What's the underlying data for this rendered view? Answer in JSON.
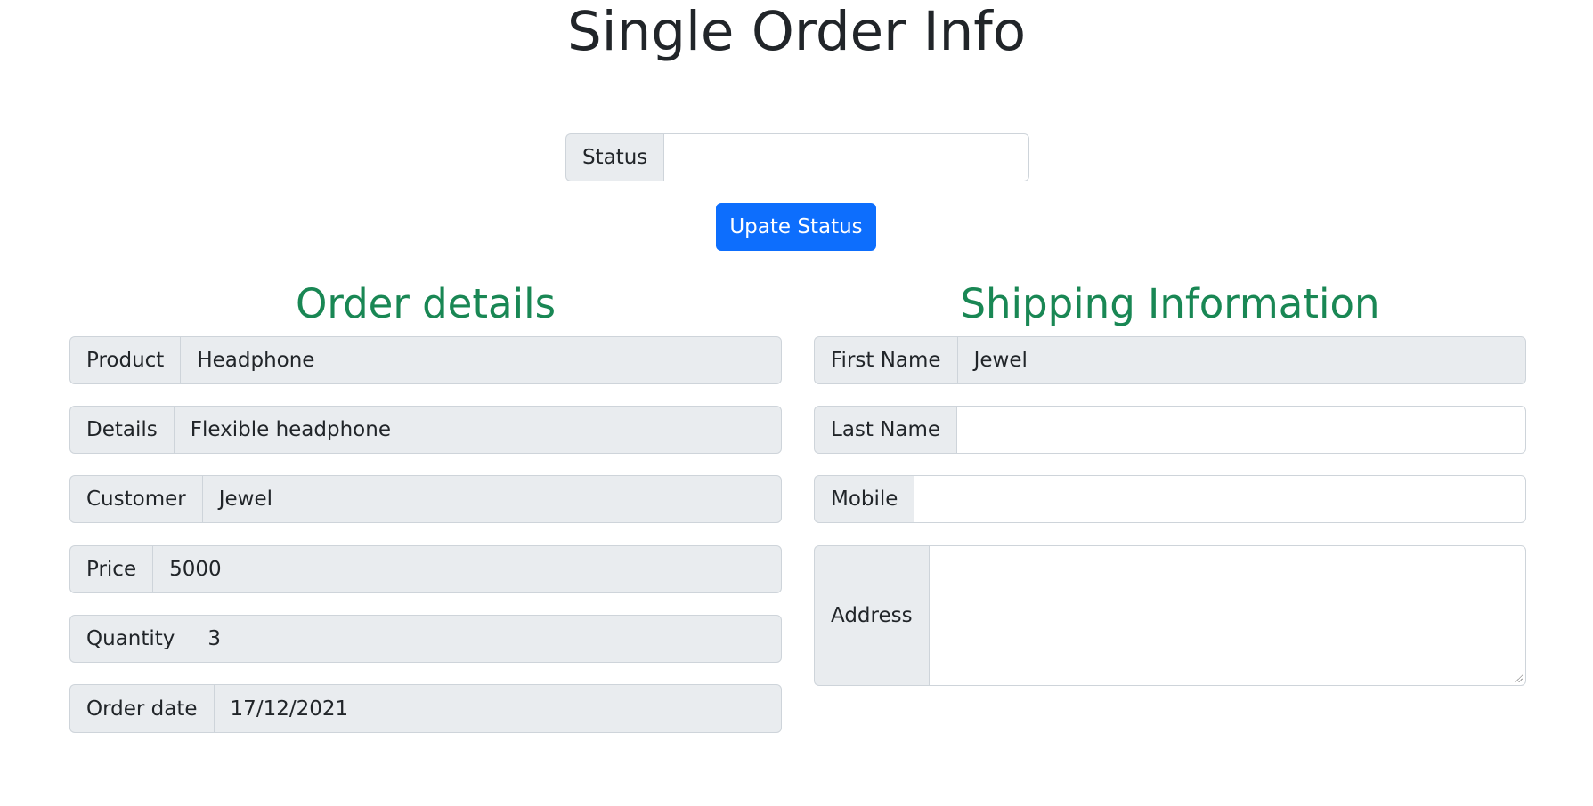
{
  "page": {
    "title": "Single Order Info"
  },
  "status_form": {
    "label": "Status",
    "value": "",
    "button_label": "Upate Status"
  },
  "order_details": {
    "title": "Order details",
    "fields": [
      {
        "label": "Product",
        "value": "Headphone"
      },
      {
        "label": "Details",
        "value": "Flexible headphone"
      },
      {
        "label": "Customer",
        "value": "Jewel"
      },
      {
        "label": "Price",
        "value": "5000"
      },
      {
        "label": "Quantity",
        "value": "3"
      },
      {
        "label": "Order date",
        "value": "17/12/2021"
      }
    ]
  },
  "shipping": {
    "title": "Shipping Information",
    "first_name": {
      "label": "First Name",
      "value": "Jewel"
    },
    "last_name": {
      "label": "Last Name",
      "value": ""
    },
    "mobile": {
      "label": "Mobile",
      "value": ""
    },
    "address": {
      "label": "Address",
      "value": ""
    }
  },
  "colors": {
    "primary": "#0d6efd",
    "section_title": "#198754",
    "addon_bg": "#e9ecef",
    "border": "#ced4da"
  }
}
